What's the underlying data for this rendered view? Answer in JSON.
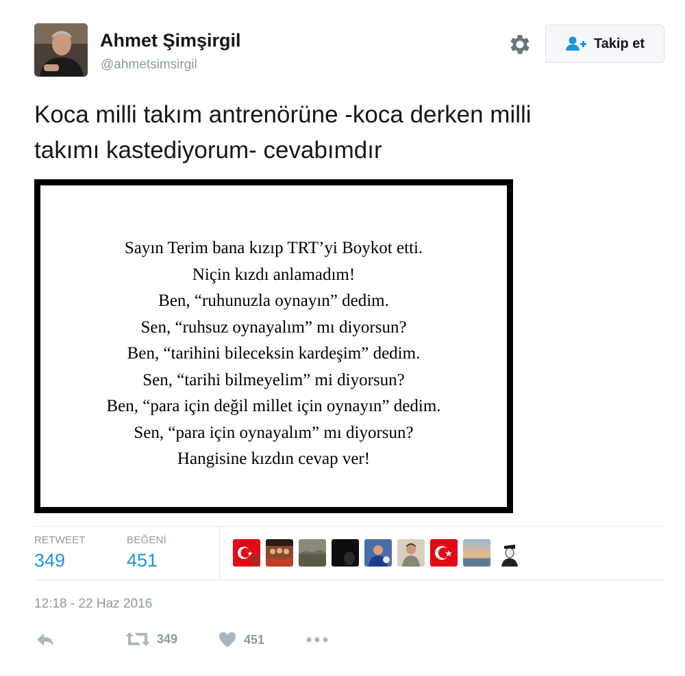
{
  "user": {
    "name": "Ahmet Şimşirgil",
    "handle": "@ahmetsimsirgil"
  },
  "follow_button": {
    "label": "Takip et"
  },
  "tweet": {
    "text_lines": [
      "Koca milli takım antrenörüne -koca derken milli",
      "takımı kastediyorum- cevabımdır"
    ]
  },
  "media": {
    "poem_lines": [
      "Sayın Terim bana kızıp TRT’yi Boykot etti.",
      "Niçin kızdı anlamadım!",
      "Ben, “ruhunuzla oynayın” dedim.",
      "Sen, “ruhsuz oynayalım” mı diyorsun?",
      "Ben, “tarihini bileceksin kardeşim” dedim.",
      "Sen, “tarihi bilmeyelim” mi diyorsun?",
      "Ben, “para için değil millet için oynayın” dedim.",
      "Sen, “para için oynayalım” mı diyorsun?",
      "Hangisine kızdın cevap ver!"
    ]
  },
  "stats": {
    "retweet_label": "RETWEET",
    "retweet_count": "349",
    "like_label": "BEĞENİ",
    "like_count": "451"
  },
  "likers": [
    "turkish-flag-avatar",
    "group-avatar",
    "landscape-avatar",
    "dark-avatar",
    "sports-avatar",
    "portrait-avatar",
    "turkish-flag-avatar",
    "sunset-avatar",
    "ataturk-sketch-avatar"
  ],
  "timestamp": "12:18 - 22 Haz 2016",
  "actions": {
    "retweet_count": "349",
    "like_count": "451"
  },
  "colors": {
    "accent": "#1b95e0",
    "muted": "#8899a6",
    "icon": "#aab8c2"
  }
}
